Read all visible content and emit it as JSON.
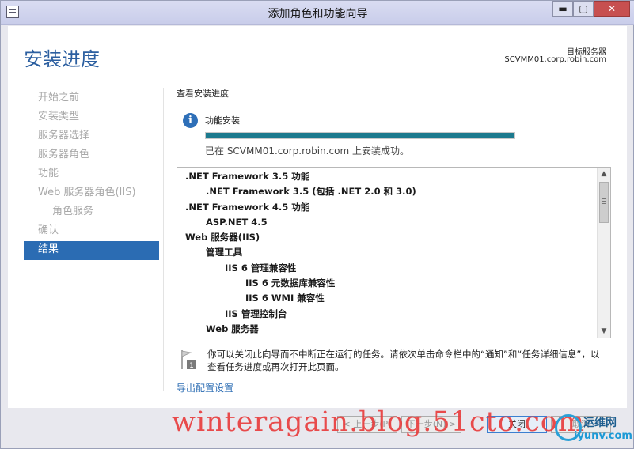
{
  "window": {
    "title": "添加角色和功能向导",
    "controls": {
      "min": "▬",
      "max": "▢",
      "close": "✕"
    }
  },
  "header": {
    "page_title": "安装进度",
    "target_label": "目标服务器",
    "target_name": "SCVMM01.corp.robin.com"
  },
  "nav": {
    "items": [
      {
        "label": "开始之前"
      },
      {
        "label": "安装类型"
      },
      {
        "label": "服务器选择"
      },
      {
        "label": "服务器角色"
      },
      {
        "label": "功能"
      },
      {
        "label": "Web 服务器角色(IIS)"
      },
      {
        "label": "角色服务"
      },
      {
        "label": "确认"
      },
      {
        "label": "结果"
      }
    ],
    "active_index": 8
  },
  "main": {
    "section_label": "查看安装进度",
    "status_title": "功能安装",
    "progress_fraction": 1.0,
    "status_text": "已在 SCVMM01.corp.robin.com 上安装成功。",
    "list": [
      {
        "level": 0,
        "text": ".NET Framework 3.5 功能"
      },
      {
        "level": 1,
        "text": ".NET Framework 3.5 (包括 .NET 2.0 和 3.0)"
      },
      {
        "level": 0,
        "text": ".NET Framework 4.5 功能"
      },
      {
        "level": 1,
        "text": "ASP.NET 4.5"
      },
      {
        "level": 0,
        "text": "Web 服务器(IIS)"
      },
      {
        "level": 1,
        "text": "管理工具"
      },
      {
        "level": 2,
        "text": "IIS 6 管理兼容性"
      },
      {
        "level": 3,
        "text": "IIS 6 元数据库兼容性"
      },
      {
        "level": 3,
        "text": "IIS 6 WMI 兼容性"
      },
      {
        "level": 2,
        "text": "IIS 管理控制台"
      },
      {
        "level": 1,
        "text": "Web 服务器"
      }
    ],
    "note_line1": "你可以关闭此向导而不中断正在运行的任务。请依次单击命令栏中的“通知”和“任务详细信息”，以",
    "note_line2": "查看任务进度或再次打开此页面。",
    "export_link": "导出配置设置"
  },
  "buttons": {
    "prev": "< 上一步(P)",
    "next": "下一步(N) >",
    "close": "关闭",
    "cancel": "取消"
  },
  "overlay": {
    "watermark": "winteragain.blog.51cto.com",
    "logo_cn": "运维网",
    "logo_en": "iyunv.com"
  },
  "colors": {
    "accent": "#2b6cb3",
    "progress": "#1c7a8e",
    "title_blue": "#2c5fa0"
  }
}
